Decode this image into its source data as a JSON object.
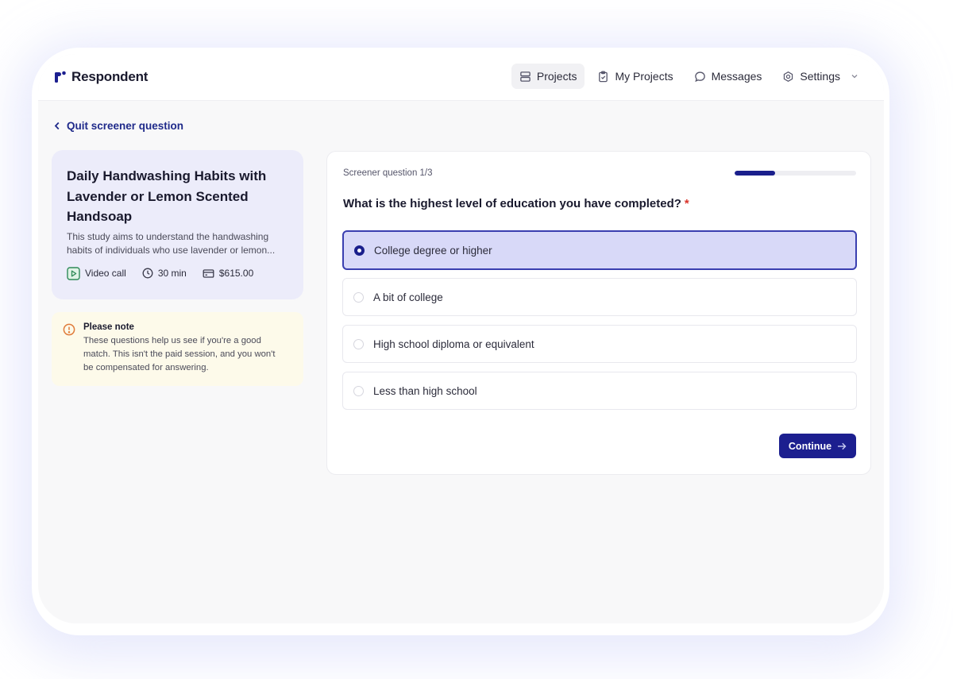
{
  "app": {
    "name": "Respondent",
    "brand_color": "#1c1f8f"
  },
  "nav": {
    "items": [
      {
        "label": "Projects",
        "icon": "server-icon",
        "active": true
      },
      {
        "label": "My Projects",
        "icon": "clipboard-check-icon",
        "active": false
      },
      {
        "label": "Messages",
        "icon": "chat-bubble-icon",
        "active": false
      },
      {
        "label": "Settings",
        "icon": "gear-icon",
        "active": false,
        "has_dropdown": true
      }
    ]
  },
  "back_link": {
    "label": "Quit screener question",
    "icon": "chevron-left-icon"
  },
  "study": {
    "title_lines": [
      "Daily Handwashing Habits with",
      "Lavender or Lemon Scented",
      "Handsoap"
    ],
    "description_lines": [
      "This study aims to understand the handwashing",
      "habits of individuals who use lavender or lemon..."
    ],
    "meta": {
      "type": "Video call",
      "duration": "30 min",
      "incentive": "$615.00"
    }
  },
  "note": {
    "title": "Please note",
    "body": "These questions help us see if you're a good match. This isn't the paid session, and you won't be compensated for answering.",
    "icon": "alert-circle-icon"
  },
  "screener": {
    "step_label": "Screener question 1/3",
    "progress": 0.333,
    "question": "What is the highest level of education you have completed?",
    "required_mark": "*",
    "options": [
      {
        "label": "College degree or higher",
        "selected": true
      },
      {
        "label": "A bit of college",
        "selected": false
      },
      {
        "label": "High school diploma or equivalent",
        "selected": false
      },
      {
        "label": "Less than high school",
        "selected": false
      }
    ],
    "continue_label": "Continue"
  }
}
